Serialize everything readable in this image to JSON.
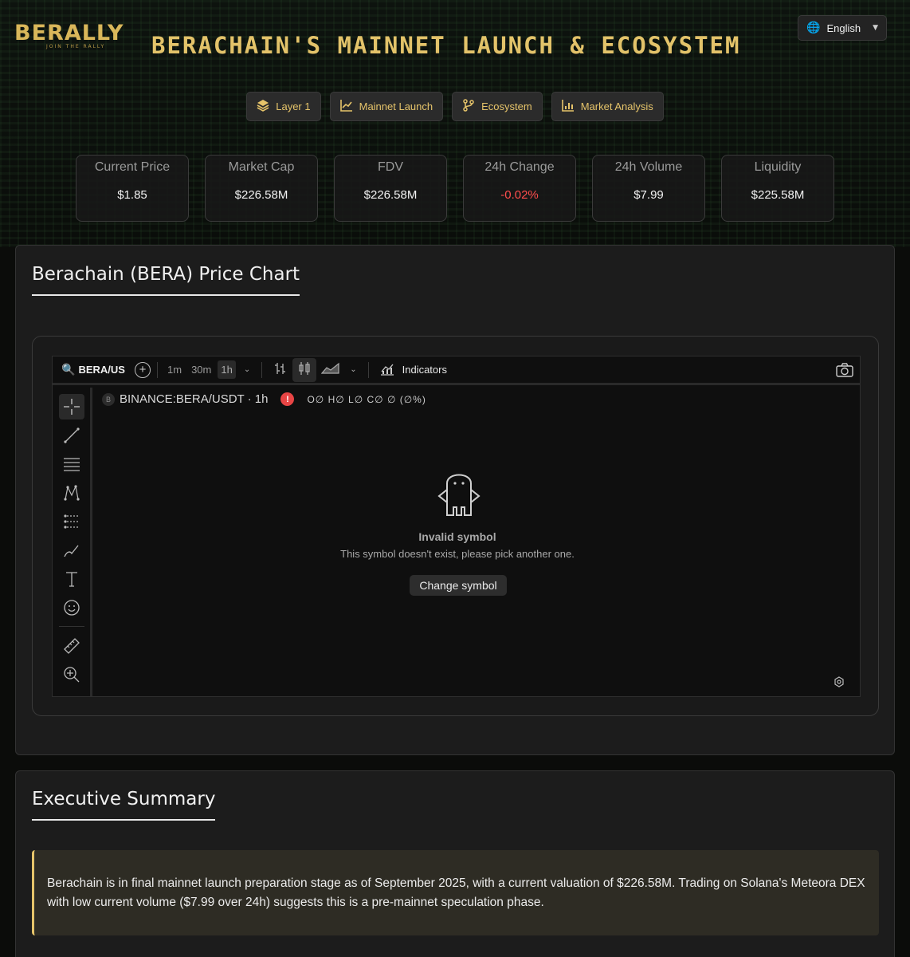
{
  "header": {
    "logo_text": "BERALLY",
    "logo_tagline": "JOIN THE RALLY",
    "title": "BERACHAIN'S MAINNET LAUNCH & ECOSYSTEM",
    "language": "English"
  },
  "nav": {
    "items": [
      {
        "label": "Layer 1",
        "icon": "layers-icon"
      },
      {
        "label": "Mainnet Launch",
        "icon": "chart-line-icon"
      },
      {
        "label": "Ecosystem",
        "icon": "git-branch-icon"
      },
      {
        "label": "Market Analysis",
        "icon": "bar-chart-icon"
      }
    ]
  },
  "stats": [
    {
      "label": "Current Price",
      "value": "$1.85"
    },
    {
      "label": "Market Cap",
      "value": "$226.58M"
    },
    {
      "label": "FDV",
      "value": "$226.58M"
    },
    {
      "label": "24h Change",
      "value": "-0.02%"
    },
    {
      "label": "24h Volume",
      "value": "$7.99"
    },
    {
      "label": "Liquidity",
      "value": "$225.58M"
    }
  ],
  "colors": {
    "accent": "#e6c46a",
    "negative": "#ff4d4d",
    "warning": "#e84545"
  },
  "price_chart": {
    "title": "Berachain (BERA) Price Chart",
    "toolbar": {
      "search_value": "BERA/US",
      "timeframes": [
        "1m",
        "30m",
        "1h"
      ],
      "active_timeframe": "1h",
      "indicators_label": "Indicators"
    },
    "legend": {
      "badge": "B",
      "symbol": "BINANCE:BERA/USDT · 1h",
      "warn": "!",
      "ohlc": "O∅ H∅ L∅ C∅ ∅ (∅%)"
    },
    "invalid_title": "Invalid symbol",
    "invalid_message": "This symbol doesn't exist, please pick another one.",
    "change_symbol_label": "Change symbol"
  },
  "summary": {
    "title": "Executive Summary",
    "text": "Berachain is in final mainnet launch preparation stage as of September 2025, with a current valuation of $226.58M. Trading on Solana's Meteora DEX with low current volume ($7.99 over 24h) suggests this is a pre-mainnet speculation phase."
  }
}
